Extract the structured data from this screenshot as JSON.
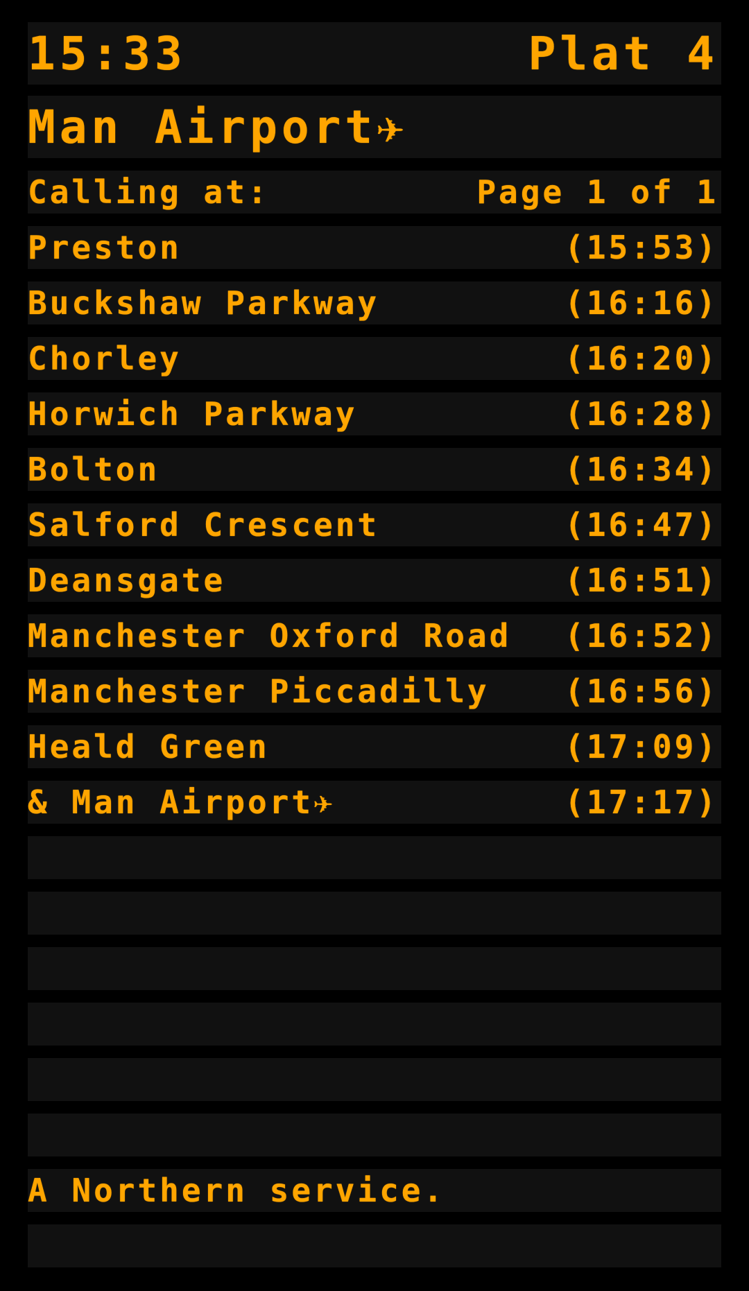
{
  "header": {
    "time": "15:33",
    "platform": "Plat 4"
  },
  "destination": "Man Airport✈",
  "calling": {
    "label": "Calling at:",
    "page": "Page 1 of 1"
  },
  "stops": [
    {
      "name": "Preston",
      "time": "(15:53)"
    },
    {
      "name": "Buckshaw Parkway",
      "time": "(16:16)"
    },
    {
      "name": "Chorley",
      "time": "(16:20)"
    },
    {
      "name": "Horwich Parkway",
      "time": "(16:28)"
    },
    {
      "name": "Bolton",
      "time": "(16:34)"
    },
    {
      "name": "Salford Crescent",
      "time": "(16:47)"
    },
    {
      "name": "Deansgate",
      "time": "(16:51)"
    },
    {
      "name": "Manchester Oxford Road",
      "time": "(16:52)"
    },
    {
      "name": "Manchester Piccadilly",
      "time": "(16:56)"
    },
    {
      "name": "Heald Green",
      "time": "(17:09)"
    },
    {
      "name": "& Man Airport✈",
      "time": "(17:17)"
    }
  ],
  "operator_message": "A Northern service.",
  "colors": {
    "led": "#FFA500",
    "row_bg": "#111111",
    "background": "#000000"
  }
}
